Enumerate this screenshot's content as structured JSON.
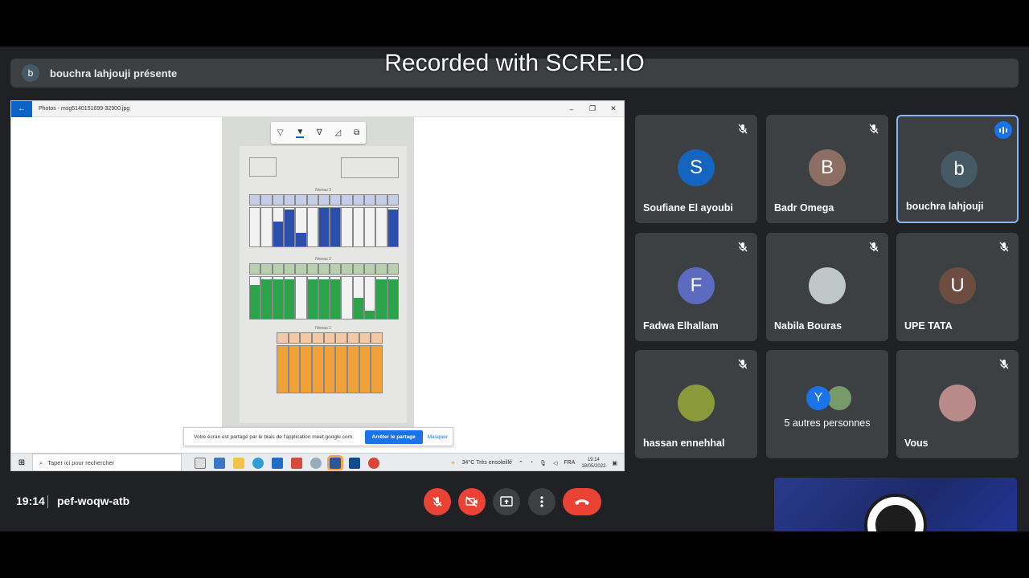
{
  "watermark": "Recorded with SCRE.IO",
  "presenter": {
    "initial": "b",
    "label": "bouchra lahjouji présente"
  },
  "shared_window": {
    "title": "Photos - msg5140151699-32900.jpg",
    "back_icon": "←",
    "minimize_icon": "–",
    "restore_icon": "❐",
    "close_icon": "✕",
    "doc": {
      "level_labels": [
        "Niveau 3",
        "Niveau 2",
        "Niveau 1"
      ]
    }
  },
  "share_banner": {
    "text": "Votre écran est partagé par le biais de l'application meet.google.com.",
    "stop_label": "Arrêter le partage",
    "hide_label": "Masquer"
  },
  "taskbar": {
    "search_placeholder": "Taper ici pour rechercher",
    "weather": "34°C  Très ensoleillé",
    "lang": "FRA",
    "time": "19:14",
    "date": "18/05/2022"
  },
  "participants": [
    {
      "name": "Soufiane El ayoubi",
      "initial": "S",
      "color": "#1565c0",
      "muted": true
    },
    {
      "name": "Badr Omega",
      "initial": "B",
      "color": "#8d6e63",
      "muted": true
    },
    {
      "name": "bouchra lahjouji",
      "initial": "b",
      "color": "#455a64",
      "muted": false,
      "speaking": true
    },
    {
      "name": "Fadwa Elhallam",
      "initial": "F",
      "color": "#5c6bc0",
      "muted": true
    },
    {
      "name": "Nabila Bouras",
      "initial": "",
      "color": "#bfc7c9",
      "muted": true
    },
    {
      "name": "UPE TATA",
      "initial": "U",
      "color": "#6d4c41",
      "muted": true
    },
    {
      "name": "hassan ennehhal",
      "initial": "",
      "color": "#8a9a3a",
      "muted": true
    },
    {
      "name": "5 autres personnes",
      "initial": "Y",
      "color": "#1a73e8",
      "muted": false
    },
    {
      "name": "Vous",
      "initial": "",
      "color": "#b88a8a",
      "muted": true
    }
  ],
  "bottom_bar": {
    "time": "19:14",
    "meeting_code": "pef-woqw-atb"
  }
}
